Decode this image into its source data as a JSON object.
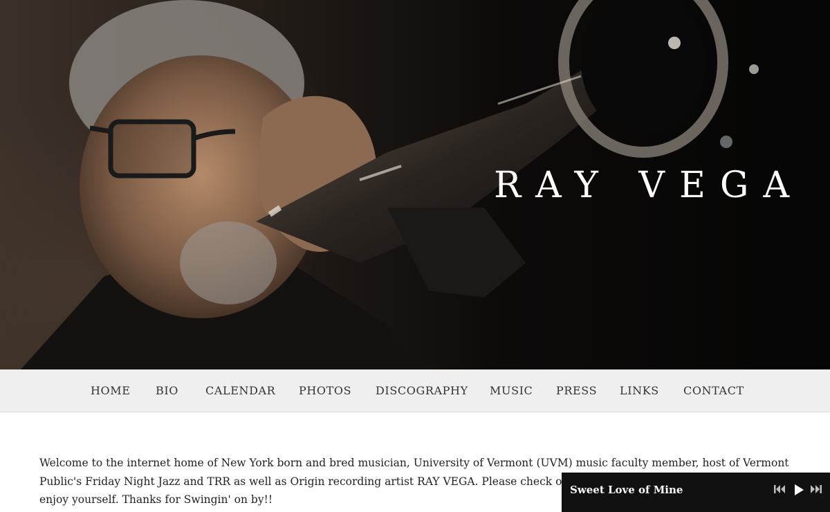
{
  "hero": {
    "site_title": "RAY VEGA"
  },
  "nav": {
    "items": [
      {
        "label": "HOME"
      },
      {
        "label": "BIO"
      },
      {
        "label": "CALENDAR"
      },
      {
        "label": "PHOTOS"
      },
      {
        "label": "DISCOGRAPHY"
      },
      {
        "label": "MUSIC"
      },
      {
        "label": "PRESS"
      },
      {
        "label": "LINKS"
      },
      {
        "label": "CONTACT"
      }
    ]
  },
  "intro": {
    "line1": "Welcome to the internet home of New York born and bred musician, University of Vermont (UVM) music faculty member, host of Vermont",
    "line2": "Public's Friday Night Jazz and TRR as well as Origin recording artist RAY VEGA. Please check out",
    "line3": "enjoy yourself. Thanks for Swingin' on by!!"
  },
  "player": {
    "track_title": "Sweet Love of Mine",
    "icons": [
      "previous-icon",
      "play-icon",
      "next-icon"
    ]
  },
  "colors": {
    "nav_bg": "#efefef",
    "player_bg": "#111111",
    "hero_title": "#ffffff"
  }
}
